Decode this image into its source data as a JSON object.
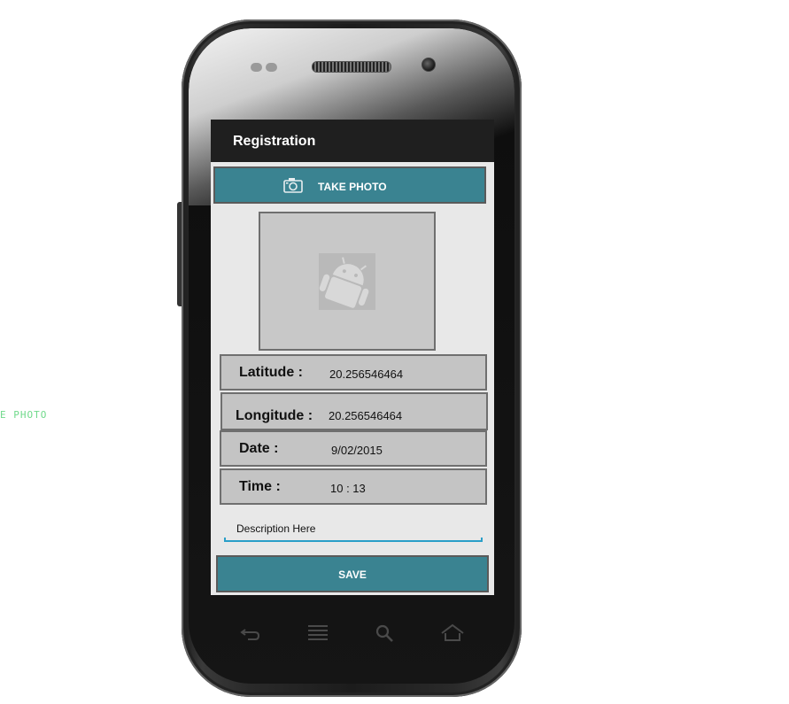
{
  "side_label": "E PHOTO",
  "app": {
    "title": "Registration"
  },
  "take_photo": {
    "label": "TAKE PHOTO",
    "icon": "camera-icon"
  },
  "photo": {
    "placeholder_icon": "android-image-placeholder-icon"
  },
  "fields": {
    "latitude": {
      "label": "Latitude :",
      "value": "20.256546464"
    },
    "longitude": {
      "label": "Longitude :",
      "value": "20.256546464"
    },
    "date": {
      "label": "Date :",
      "value": "9/02/2015"
    },
    "time": {
      "label": "Time :",
      "value": "10 : 13"
    }
  },
  "description": {
    "value": "Description Here"
  },
  "save": {
    "label": "SAVE"
  },
  "nav": {
    "back_icon": "back-icon",
    "menu_icon": "menu-icon",
    "search_icon": "search-icon",
    "home_icon": "home-icon"
  },
  "colors": {
    "action_bar": "#1f1f1f",
    "accent": "#3a8391",
    "field_bg": "#c4c4c4",
    "screen_bg": "#e8e8e8",
    "underline": "#2a9fc8"
  }
}
